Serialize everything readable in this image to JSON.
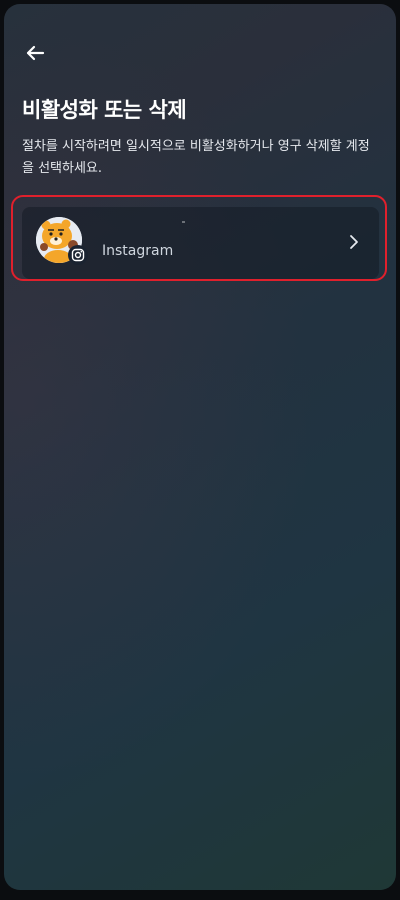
{
  "header": {
    "back_icon": "arrow-left-icon",
    "title": "비활성화 또는 삭제",
    "description": "절차를 시작하려면 일시적으로 비활성화하거나 영구 삭제할 계정을 선택하세요."
  },
  "accounts": [
    {
      "platform": "Instagram",
      "avatar_icon": "cartoon-lion-avatar",
      "badge_icon": "instagram-icon",
      "chevron_icon": "chevron-right-icon"
    }
  ],
  "colors": {
    "highlight": "#e0202c",
    "text_primary": "#ffffff",
    "text_secondary": "#cfd6de"
  }
}
